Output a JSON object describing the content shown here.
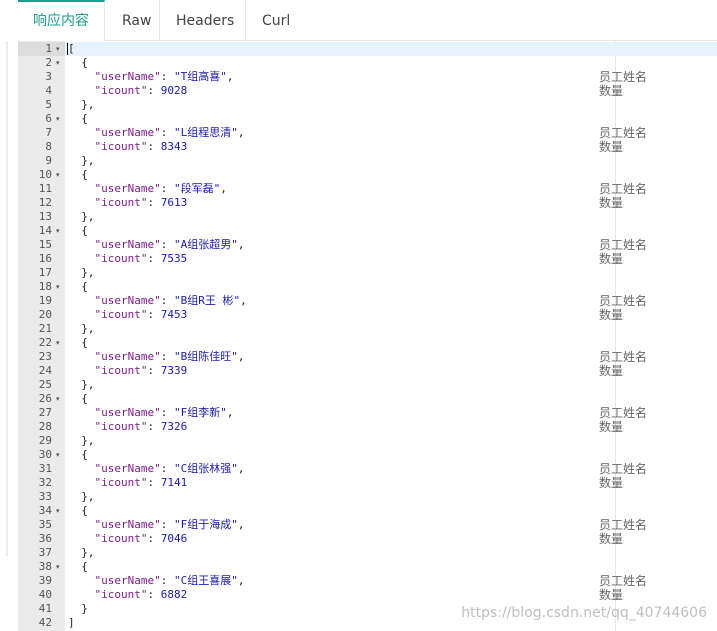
{
  "tabs": [
    {
      "label": "响应内容",
      "active": true
    },
    {
      "label": "Raw",
      "active": false
    },
    {
      "label": "Headers",
      "active": false
    },
    {
      "label": "Curl",
      "active": false
    }
  ],
  "editor": {
    "open_bracket": "[",
    "close_bracket": "]",
    "open_brace": "{",
    "close_brace": "},",
    "last_close_brace": "}",
    "key_username": "\"userName\"",
    "key_icount": "\"icount\"",
    "comment_username": "员工姓名",
    "comment_icount": "数量",
    "line_count": 42,
    "fold_lines": [
      1,
      2,
      6,
      10,
      14,
      18,
      22,
      26,
      30,
      34,
      38
    ],
    "records": [
      {
        "userName": "\"T组高喜\"",
        "icount": "9028"
      },
      {
        "userName": "\"L组程思清\"",
        "icount": "8343"
      },
      {
        "userName": "\"段军磊\"",
        "icount": "7613"
      },
      {
        "userName": "\"A组张超男\"",
        "icount": "7535"
      },
      {
        "userName": "\"B组R王 彬\"",
        "icount": "7453"
      },
      {
        "userName": "\"B组陈佳旺\"",
        "icount": "7339"
      },
      {
        "userName": "\"F组李新\"",
        "icount": "7326"
      },
      {
        "userName": "\"C组张林强\"",
        "icount": "7141"
      },
      {
        "userName": "\"F组于海成\"",
        "icount": "7046"
      },
      {
        "userName": "\"C组王喜展\"",
        "icount": "6882"
      }
    ]
  },
  "watermark": "https://blog.csdn.net/qq_40744606",
  "colors": {
    "accent": "#1a9e8f",
    "gutter": "#ebebeb",
    "string": "#1b1bb3",
    "key": "#7c1f86"
  },
  "icons": {
    "fold": "triangle-down"
  }
}
